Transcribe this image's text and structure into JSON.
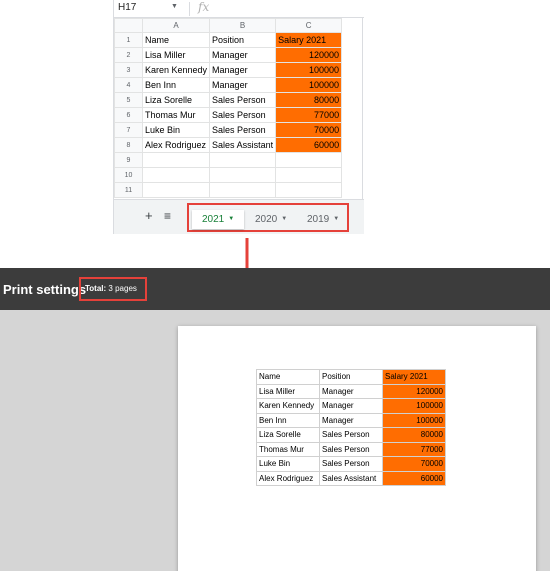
{
  "formula_bar": {
    "cell_ref": "H17",
    "fx_label": "fx"
  },
  "sheet": {
    "column_headers": [
      "A",
      "B",
      "C"
    ],
    "row_numbers": [
      "1",
      "2",
      "3",
      "4",
      "5",
      "6",
      "7",
      "8",
      "9",
      "10",
      "11"
    ],
    "rows": [
      [
        "Name",
        "Position",
        "Salary 2021"
      ],
      [
        "Lisa Miller",
        "Manager",
        "120000"
      ],
      [
        "Karen Kennedy",
        "Manager",
        "100000"
      ],
      [
        "Ben Inn",
        "Manager",
        "100000"
      ],
      [
        "Liza Sorelle",
        "Sales Person",
        "80000"
      ],
      [
        "Thomas Mur",
        "Sales Person",
        "77000"
      ],
      [
        "Luke Bin",
        "Sales Person",
        "70000"
      ],
      [
        "Alex Rodriguez",
        "Sales Assistant",
        "60000"
      ],
      [
        "",
        "",
        ""
      ],
      [
        "",
        "",
        ""
      ],
      [
        "",
        "",
        ""
      ]
    ],
    "highlight_color": "#ff6d01"
  },
  "sheet_tabs": {
    "add_icon": "plus-icon",
    "all_sheets_icon": "list-icon",
    "tabs": [
      {
        "label": "2021",
        "active": true
      },
      {
        "label": "2020",
        "active": false
      },
      {
        "label": "2019",
        "active": false
      }
    ],
    "active_color": "#188038"
  },
  "print_settings": {
    "title": "Print settings",
    "total_label": "Total:",
    "total_value": "3 pages"
  },
  "preview": {
    "rows": [
      [
        "Name",
        "Position",
        "Salary 2021"
      ],
      [
        "Lisa Miller",
        "Manager",
        "120000"
      ],
      [
        "Karen Kennedy",
        "Manager",
        "100000"
      ],
      [
        "Ben Inn",
        "Manager",
        "100000"
      ],
      [
        "Liza Sorelle",
        "Sales Person",
        "80000"
      ],
      [
        "Thomas Mur",
        "Sales Person",
        "77000"
      ],
      [
        "Luke Bin",
        "Sales Person",
        "70000"
      ],
      [
        "Alex Rodriguez",
        "Sales Assistant",
        "60000"
      ]
    ]
  },
  "colors": {
    "annotation_red": "#e5413a",
    "print_bar_bg": "#3c3c3c",
    "preview_bg": "#d5d5d5"
  }
}
